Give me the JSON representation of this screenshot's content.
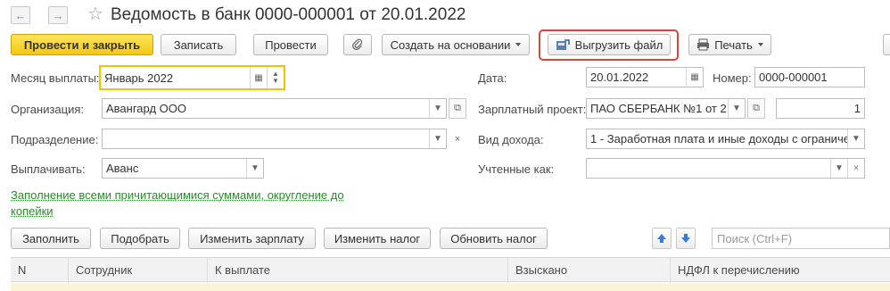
{
  "window": {
    "title": "Ведомость в банк 0000-000001 от 20.01.2022"
  },
  "toolbar": {
    "post_close": "Провести и закрыть",
    "save": "Записать",
    "post": "Провести",
    "create_based": "Создать на основании",
    "export_file": "Выгрузить файл",
    "print": "Печать"
  },
  "form": {
    "payment_month_label": "Месяц выплаты:",
    "payment_month_value": "Январь 2022",
    "organization_label": "Организация:",
    "organization_value": "Авангард ООО",
    "department_label": "Подразделение:",
    "department_value": "",
    "pay_label": "Выплачивать:",
    "pay_value": "Аванс",
    "date_label": "Дата:",
    "date_value": "20.01.2022",
    "number_label": "Номер:",
    "number_value": "0000-000001",
    "salary_project_label": "Зарплатный проект:",
    "salary_project_value": "ПАО СБЕРБАНК №1 от 2",
    "salary_project_count": "1",
    "income_type_label": "Вид дохода:",
    "income_type_value": "1 - Заработная плата и иные доходы с ограниче",
    "counted_as_label": "Учтенные как:",
    "counted_as_value": ""
  },
  "fill_link": {
    "line1": "Заполнение всеми причитающимися суммами, округление до",
    "line2": "копейки"
  },
  "table_toolbar": {
    "fill": "Заполнить",
    "pick": "Подобрать",
    "change_salary": "Изменить зарплату",
    "change_tax": "Изменить налог",
    "update_tax": "Обновить налог",
    "search_placeholder": "Поиск (Ctrl+F)"
  },
  "table": {
    "columns": [
      "N",
      "Сотрудник",
      "К выплате",
      "Взыскано",
      "НДФЛ к перечислению"
    ]
  },
  "colors": {
    "primary_button": "#f3c814",
    "highlight_border": "#d9453a",
    "link": "#2b8a2b"
  }
}
